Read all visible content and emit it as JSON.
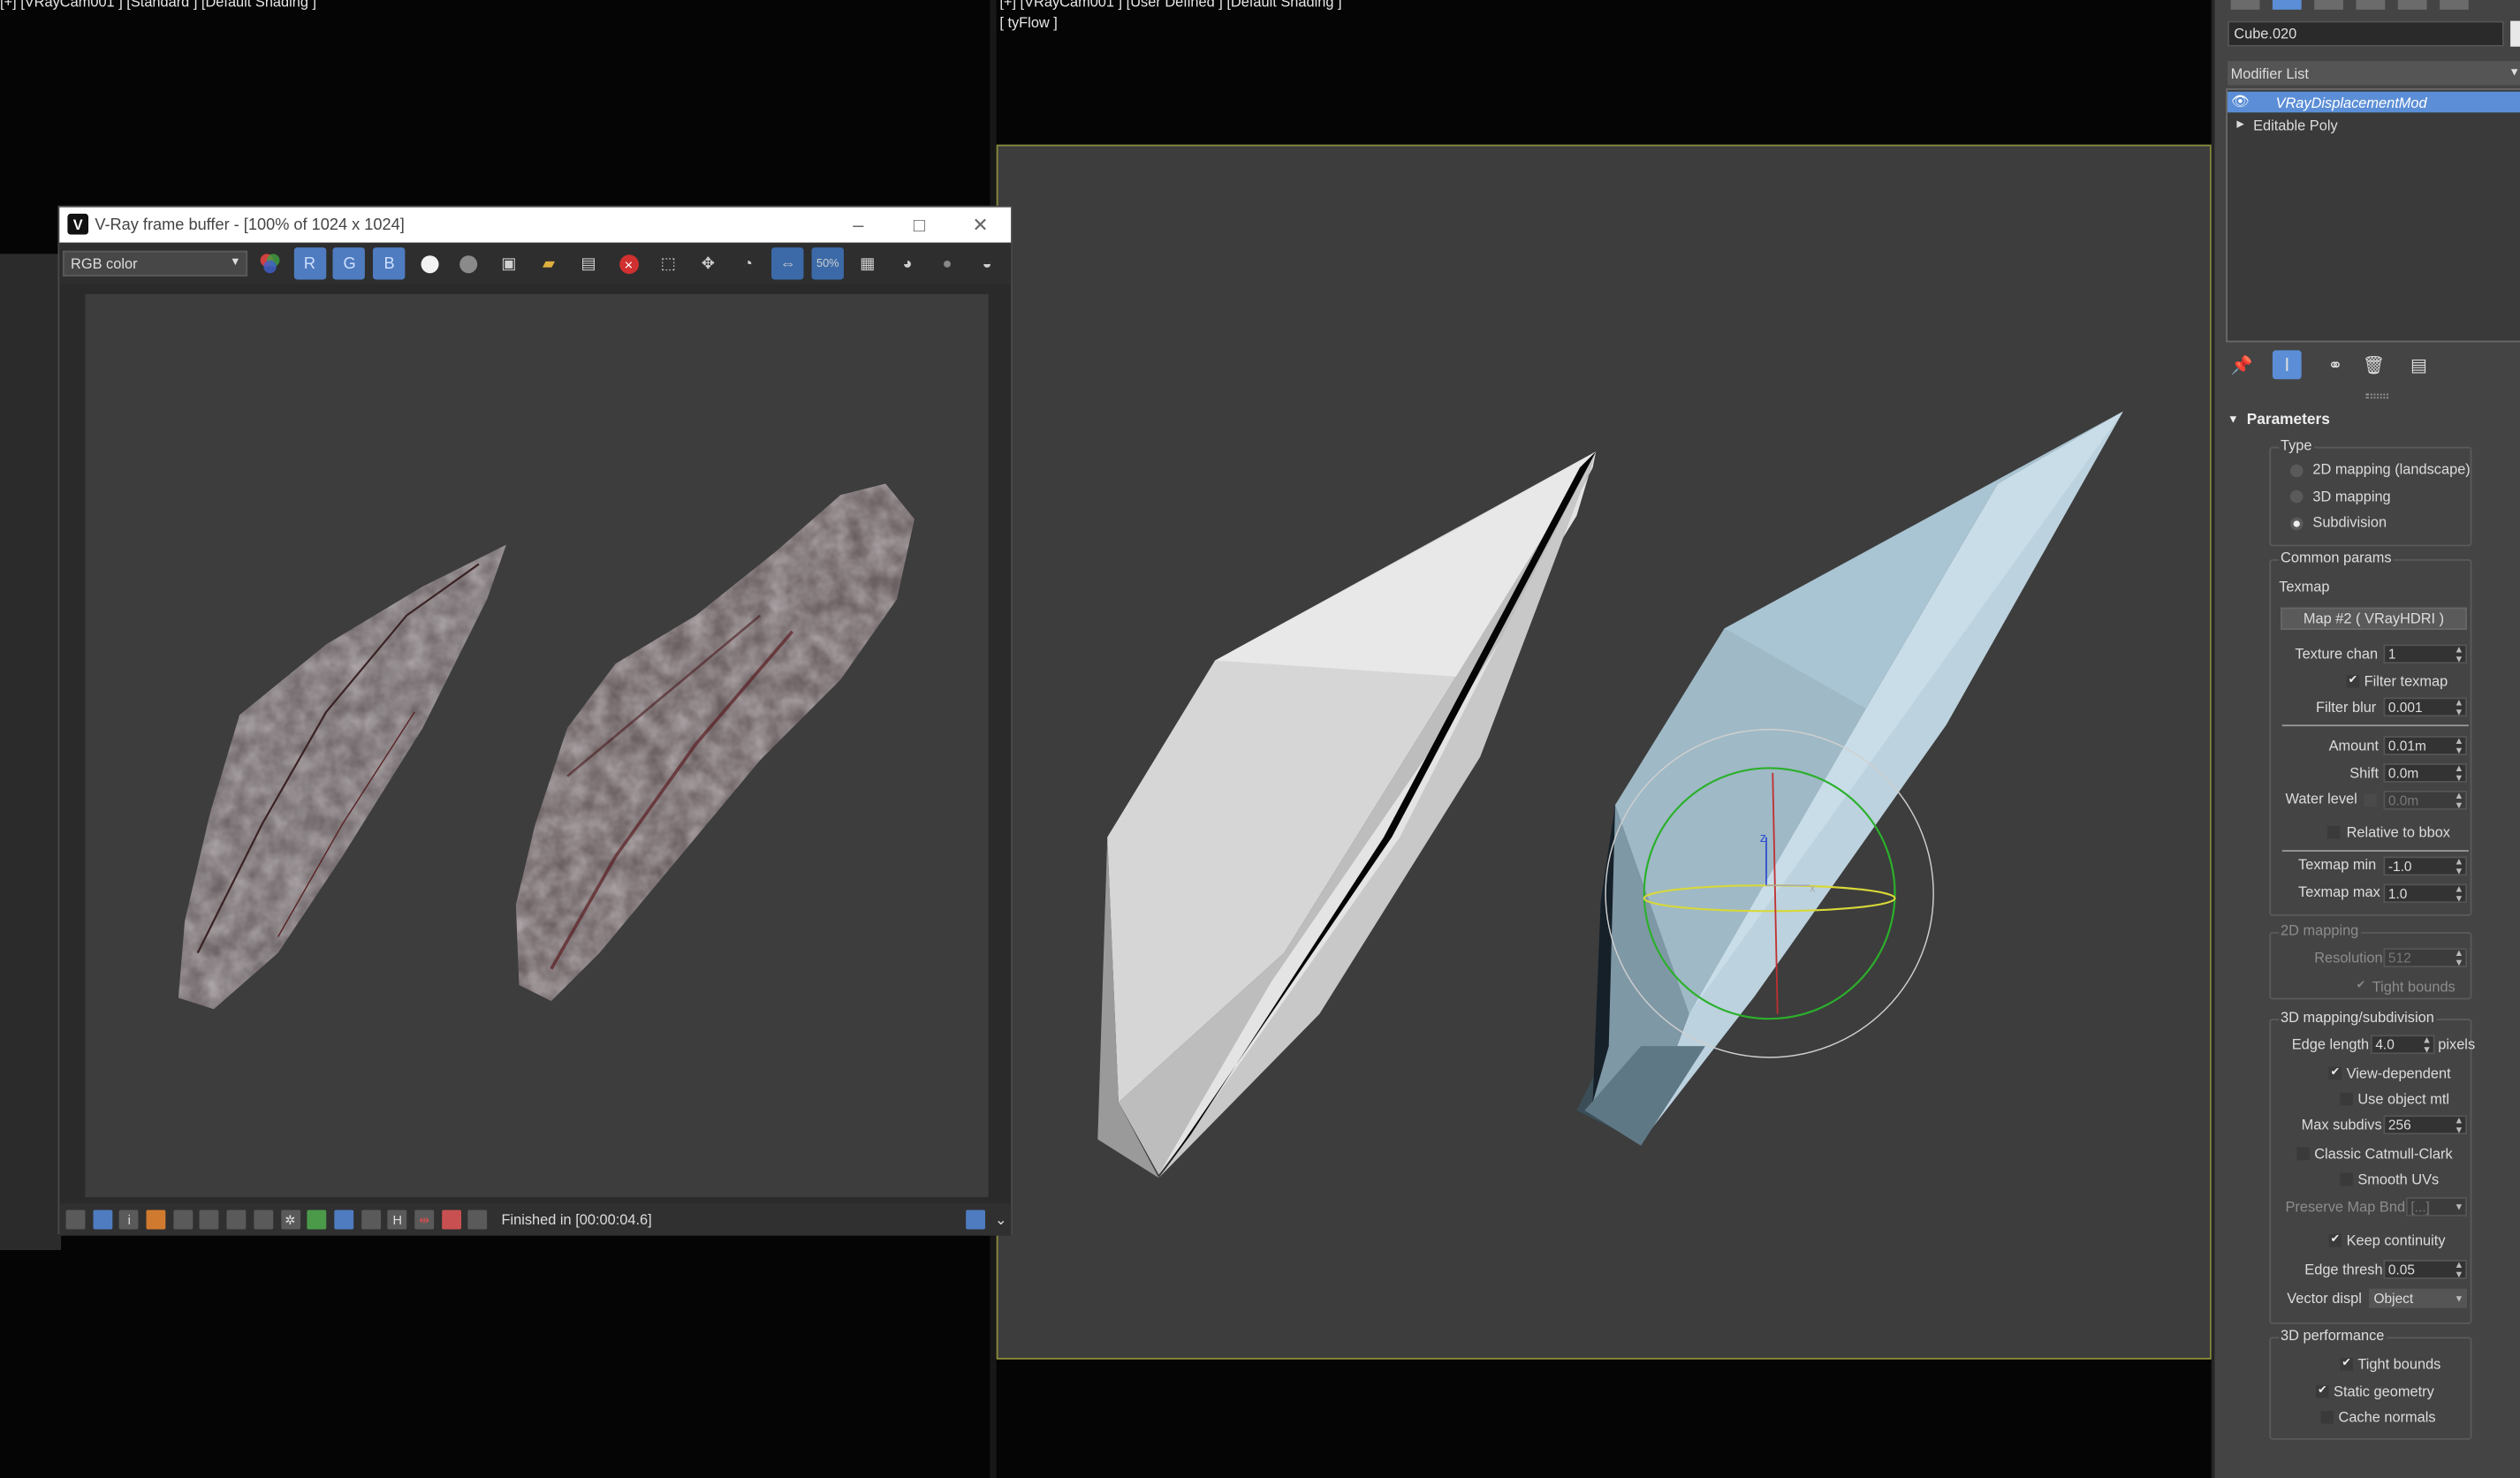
{
  "viewports": {
    "left_label": "[+] [VRayCam001 ] [Standard ] [Default Shading ]",
    "right_label": "[+] [VRayCam001 ] [User Defined ] [Default Shading ]",
    "right_sublabel": "[ tyFlow ]"
  },
  "vfb": {
    "title": "V-Ray frame buffer - [100% of 1024 x 1024]",
    "channel": "RGB color",
    "status": "Finished in [00:00:04.6]",
    "toolbar_icons": [
      "color-picker-icon",
      "red-channel-icon",
      "green-channel-icon",
      "blue-channel-icon",
      "alpha-white-icon",
      "mono-icon",
      "save-icon",
      "open-icon",
      "clear-icon",
      "stop-icon",
      "region-icon",
      "track-mouse-icon",
      "render-last-icon",
      "lens-effects-icon",
      "zoom-50-icon",
      "history-icon",
      "region-render-icon",
      "stop-render-icon",
      "teapot-icon"
    ],
    "channel_letters": {
      "r": "R",
      "g": "G",
      "b": "B"
    }
  },
  "panel": {
    "object_name": "Cube.020",
    "modifier_list": "Modifier List",
    "stack": [
      "VRayDisplacementMod",
      "Editable Poly"
    ],
    "rollout_title": "Parameters",
    "type": {
      "title": "Type",
      "options": [
        "2D mapping (landscape)",
        "3D mapping",
        "Subdivision"
      ],
      "selected": "Subdivision"
    },
    "common": {
      "title": "Common params",
      "texmap_label": "Texmap",
      "texmap_button": "Map #2  ( VRayHDRI )",
      "texture_chan_label": "Texture chan",
      "texture_chan": "1",
      "filter_texmap": "Filter texmap",
      "filter_blur_label": "Filter blur",
      "filter_blur": "0.001",
      "amount_label": "Amount",
      "amount": "0.01m",
      "shift_label": "Shift",
      "shift": "0.0m",
      "water_level_label": "Water level",
      "water_level": "0.0m",
      "relative_bbox": "Relative to bbox",
      "texmap_min_label": "Texmap min",
      "texmap_min": "-1.0",
      "texmap_max_label": "Texmap max",
      "texmap_max": "1.0"
    },
    "mapping2d": {
      "title": "2D mapping",
      "resolution_label": "Resolution",
      "resolution": "512",
      "tight_bounds": "Tight bounds"
    },
    "mapping3d": {
      "title": "3D mapping/subdivision",
      "edge_length_label": "Edge length",
      "edge_length": "4.0",
      "pixels": "pixels",
      "view_dependent": "View-dependent",
      "use_object_mtl": "Use object mtl",
      "max_subdivs_label": "Max subdivs",
      "max_subdivs": "256",
      "classic_cc": "Classic Catmull-Clark",
      "smooth_uvs": "Smooth UVs",
      "preserve_label": "Preserve Map Bnd",
      "preserve_value": "[...]",
      "keep_continuity": "Keep continuity",
      "edge_thresh_label": "Edge thresh",
      "edge_thresh": "0.05",
      "vector_displ_label": "Vector displ",
      "vector_displ": "Object"
    },
    "performance": {
      "title": "3D performance",
      "tight_bounds": "Tight bounds",
      "static_geometry": "Static geometry",
      "cache_normals": "Cache normals"
    }
  }
}
